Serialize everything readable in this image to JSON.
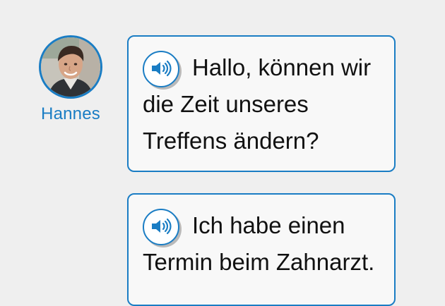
{
  "speaker": {
    "name": "Hannes",
    "avatar_icon": "portrait-photo"
  },
  "messages": [
    {
      "audio_icon": "speaker-icon",
      "text": "Hallo, können wir die Zeit unseres Treffens ändern?"
    },
    {
      "audio_icon": "speaker-icon",
      "text": "Ich habe einen Termin beim Zahnarzt."
    }
  ],
  "colors": {
    "accent": "#1a7dc4",
    "background": "#efefef",
    "bubble": "#f8f8f8",
    "text": "#111111"
  }
}
